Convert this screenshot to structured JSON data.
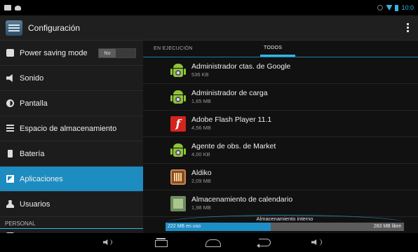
{
  "status_bar": {
    "time": "10:0",
    "icons": [
      "image-icon",
      "cat-icon",
      "alarm-icon",
      "wifi-icon",
      "battery-icon"
    ]
  },
  "action_bar": {
    "title": "Configuración",
    "icon": "settings-app-icon",
    "menu_icon": "overflow-menu-icon"
  },
  "sidebar": {
    "items": [
      {
        "label": "Power saving mode",
        "icon": "power-icon",
        "toggle": "No"
      },
      {
        "label": "Sonido",
        "icon": "sound-icon"
      },
      {
        "label": "Pantalla",
        "icon": "display-icon"
      },
      {
        "label": "Espacio de almacenamiento",
        "icon": "storage-icon"
      },
      {
        "label": "Batería",
        "icon": "battery-icon"
      },
      {
        "label": "Aplicaciones",
        "icon": "apps-icon",
        "active": true
      },
      {
        "label": "Usuarios",
        "icon": "users-icon"
      }
    ],
    "section_header": "PERSONAL"
  },
  "tabs": [
    {
      "label": "EN EJECUCIÓN"
    },
    {
      "label": "TODOS",
      "selected": true
    }
  ],
  "apps": [
    {
      "name": "Administrador ctas. de Google",
      "size": "536 KB",
      "icon": "android-app-icon"
    },
    {
      "name": "Administrador de carga",
      "size": "1,65 MB",
      "icon": "android-app-icon"
    },
    {
      "name": "Adobe Flash Player 11.1",
      "size": "4,56 MB",
      "icon": "flash-player-icon",
      "icon_glyph": "f"
    },
    {
      "name": "Agente de obs. de Market",
      "size": "4,00 KB",
      "icon": "android-app-icon"
    },
    {
      "name": "Aldiko",
      "size": "2,09 MB",
      "icon": "aldiko-icon"
    },
    {
      "name": "Almacenamiento de calendario",
      "size": "1,98 MB",
      "icon": "calendar-storage-icon"
    }
  ],
  "storage": {
    "title": "Almacenamiento interno",
    "used_label": "222 MB en uso",
    "free_label": "283 MB libre",
    "used_fraction": 0.44,
    "colors": {
      "used": "#1e8fc6",
      "free": "#5c5c5c"
    }
  },
  "nav_bar": {
    "icons": [
      "volume-down-icon",
      "recent-apps-icon",
      "home-icon",
      "back-icon",
      "volume-up-icon"
    ]
  },
  "colors": {
    "accent": "#33b5e5",
    "active_item": "#1d8cc0",
    "android_green": "#8fc439",
    "flash_red": "#d5231e"
  }
}
